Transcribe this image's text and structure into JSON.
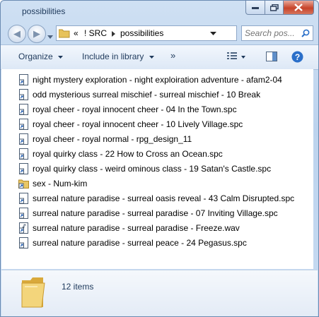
{
  "window": {
    "title": "possibilities"
  },
  "address": {
    "overflow": "«",
    "crumbs": [
      "! SRC",
      "possibilities"
    ]
  },
  "search": {
    "placeholder": "Search pos..."
  },
  "toolbar": {
    "organize": "Organize",
    "include": "Include in library",
    "more": "»"
  },
  "files": [
    {
      "name": "night mystery exploration - night exploiration adventure - afam2-04",
      "icon": "shortcut-icon"
    },
    {
      "name": "odd mysterious surreal mischief - surreal mischief - 10 Break",
      "icon": "shortcut-icon"
    },
    {
      "name": "royal cheer - royal innocent cheer - 04 In the Town.spc",
      "icon": "shortcut-icon"
    },
    {
      "name": "royal cheer - royal innocent cheer - 10 Lively Village.spc",
      "icon": "shortcut-icon"
    },
    {
      "name": "royal cheer - royal normal - rpg_design_11",
      "icon": "shortcut-icon"
    },
    {
      "name": "royal quirky class - 22 How to Cross an Ocean.spc",
      "icon": "shortcut-icon"
    },
    {
      "name": "royal quirky class - weird ominous class - 19 Satan's Castle.spc",
      "icon": "shortcut-icon"
    },
    {
      "name": "sex - Num-kim",
      "icon": "folder-shortcut-icon"
    },
    {
      "name": "surreal nature paradise - surreal oasis reveal - 43 Calm Disrupted.spc",
      "icon": "shortcut-icon"
    },
    {
      "name": "surreal nature paradise - surreal paradise - 07 Inviting Village.spc",
      "icon": "shortcut-icon"
    },
    {
      "name": "surreal nature paradise - surreal paradise - Freeze.wav",
      "icon": "audio-shortcut-icon"
    },
    {
      "name": "surreal nature paradise - surreal peace - 24 Pegasus.spc",
      "icon": "shortcut-icon"
    }
  ],
  "status": {
    "count": "12 items"
  },
  "colors": {
    "frame": "#bcd3ee",
    "accent": "#2a6fc9",
    "close": "#c7432a"
  }
}
